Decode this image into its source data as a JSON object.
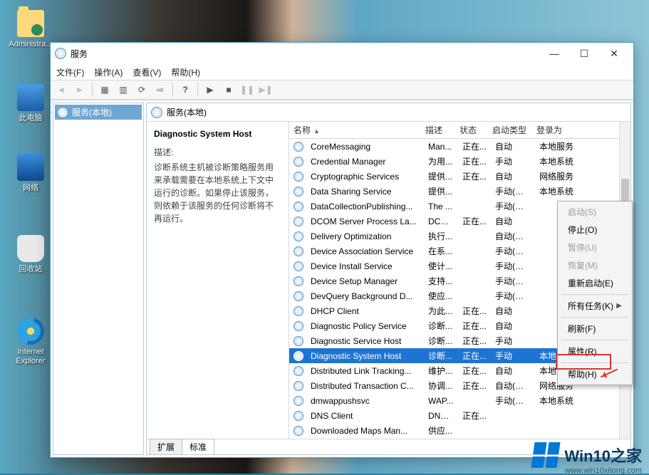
{
  "desktop_icons": {
    "admin": "Administra...",
    "this_pc": "此电脑",
    "network": "网络",
    "recycle": "回收站",
    "ie": "Internet\nExplorer"
  },
  "window": {
    "title": "服务",
    "min": "—",
    "max": "☐",
    "close": "✕"
  },
  "menu": {
    "file": "文件(F)",
    "action": "操作(A)",
    "view": "查看(V)",
    "help": "帮助(H)"
  },
  "left_tree_node": "服务(本地)",
  "right_header": "服务(本地)",
  "detail": {
    "name": "Diagnostic System Host",
    "desc_label": "描述:",
    "desc_text": "诊断系统主机被诊断策略服务用来承载需要在本地系统上下文中运行的诊断。如果停止该服务，则依赖于该服务的任何诊断将不再运行。"
  },
  "columns": {
    "name": "名称",
    "desc": "描述",
    "status": "状态",
    "startup": "启动类型",
    "logon": "登录为"
  },
  "rows": [
    {
      "n": "CoreMessaging",
      "d": "Man...",
      "s": "正在...",
      "t": "自动",
      "l": "本地服务"
    },
    {
      "n": "Credential Manager",
      "d": "为用...",
      "s": "正在...",
      "t": "手动",
      "l": "本地系统"
    },
    {
      "n": "Cryptographic Services",
      "d": "提供...",
      "s": "正在...",
      "t": "自动",
      "l": "网络服务"
    },
    {
      "n": "Data Sharing Service",
      "d": "提供...",
      "s": "",
      "t": "手动(触发...",
      "l": "本地系统"
    },
    {
      "n": "DataCollectionPublishing...",
      "d": "The ...",
      "s": "",
      "t": "手动(触发...",
      "l": ""
    },
    {
      "n": "DCOM Server Process La...",
      "d": "DCO...",
      "s": "正在...",
      "t": "自动",
      "l": ""
    },
    {
      "n": "Delivery Optimization",
      "d": "执行...",
      "s": "",
      "t": "自动(延迟...",
      "l": ""
    },
    {
      "n": "Device Association Service",
      "d": "在系...",
      "s": "",
      "t": "手动(触发...",
      "l": ""
    },
    {
      "n": "Device Install Service",
      "d": "使计...",
      "s": "",
      "t": "手动(触发...",
      "l": ""
    },
    {
      "n": "Device Setup Manager",
      "d": "支持...",
      "s": "",
      "t": "手动(触发...",
      "l": ""
    },
    {
      "n": "DevQuery Background D...",
      "d": "使应...",
      "s": "",
      "t": "手动(触发...",
      "l": ""
    },
    {
      "n": "DHCP Client",
      "d": "为此...",
      "s": "正在...",
      "t": "自动",
      "l": ""
    },
    {
      "n": "Diagnostic Policy Service",
      "d": "诊断...",
      "s": "正在...",
      "t": "自动",
      "l": ""
    },
    {
      "n": "Diagnostic Service Host",
      "d": "诊断...",
      "s": "正在...",
      "t": "手动",
      "l": ""
    },
    {
      "n": "Diagnostic System Host",
      "d": "诊断...",
      "s": "正在...",
      "t": "手动",
      "l": "本地系统",
      "sel": true
    },
    {
      "n": "Distributed Link Tracking...",
      "d": "维护...",
      "s": "正在...",
      "t": "自动",
      "l": "本地系统"
    },
    {
      "n": "Distributed Transaction C...",
      "d": "协调...",
      "s": "正在...",
      "t": "自动(延迟...",
      "l": "网络服务"
    },
    {
      "n": "dmwappushsvc",
      "d": "WAP...",
      "s": "",
      "t": "手动(触发...",
      "l": "本地系统"
    },
    {
      "n": "DNS Client",
      "d": "DNS ...",
      "s": "正在...",
      "t": "",
      "l": ""
    },
    {
      "n": "Downloaded Maps Man...",
      "d": "供应...",
      "s": "",
      "t": "",
      "l": ""
    }
  ],
  "tabs": {
    "extended": "扩展",
    "standard": "标准"
  },
  "context_menu": {
    "start": "启动(S)",
    "stop": "停止(O)",
    "pause": "暂停(U)",
    "resume": "恢复(M)",
    "restart": "重新启动(E)",
    "all_tasks": "所有任务(K)",
    "refresh": "刷新(F)",
    "properties": "属性(R)",
    "help": "帮助(H)"
  },
  "watermark": {
    "text": "Win10之家",
    "url": "www.win10xitong.com"
  }
}
